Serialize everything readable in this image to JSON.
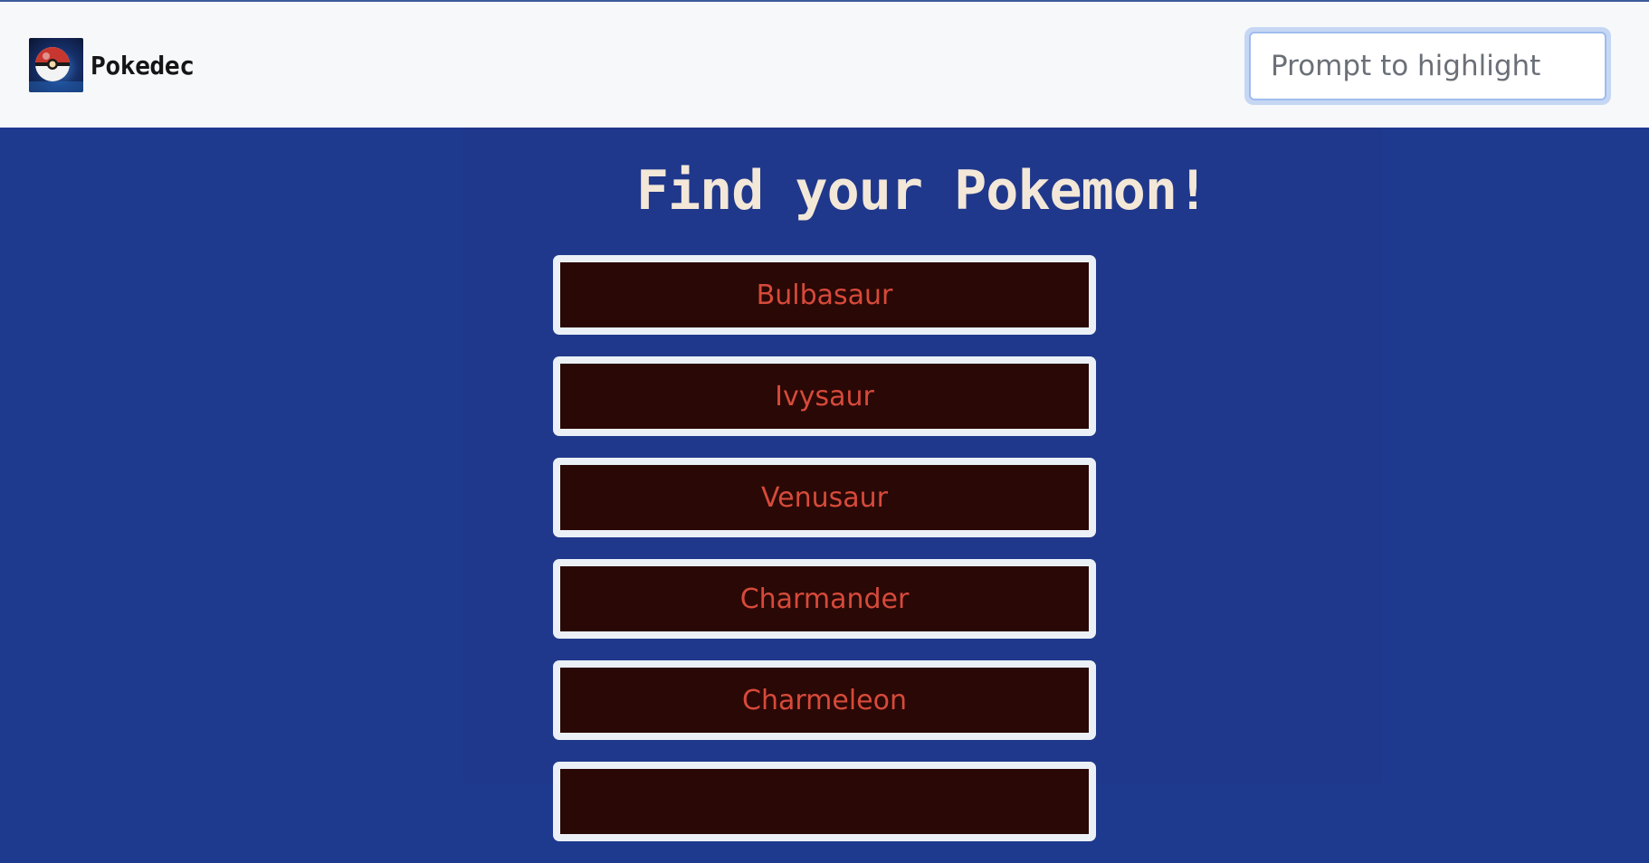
{
  "brand": {
    "name": "Pokedec",
    "logo_icon": "pokeball-logo-icon"
  },
  "search": {
    "placeholder": "Prompt to highlight",
    "value": ""
  },
  "main": {
    "title": "Find your Pokemon!",
    "pokemon": [
      {
        "name": "Bulbasaur"
      },
      {
        "name": "Ivysaur"
      },
      {
        "name": "Venusaur"
      },
      {
        "name": "Charmander"
      },
      {
        "name": "Charmeleon"
      },
      {
        "name": ""
      }
    ]
  },
  "colors": {
    "navbar_bg": "#f7f8fa",
    "page_bg": "#1e3a8f",
    "title_text": "#f3e7d8",
    "card_border": "#eaf0f6",
    "card_bg": "#2a0805",
    "card_text": "#d64a3a"
  }
}
